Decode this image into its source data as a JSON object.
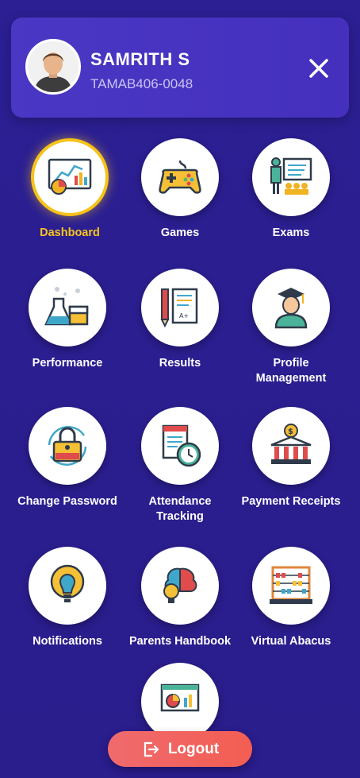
{
  "profile": {
    "name": "SAMRITH S",
    "id": "TAMAB406-0048",
    "avatar_icon": "user-avatar-icon"
  },
  "close_icon": "close-icon",
  "menu": [
    {
      "label": "Dashboard",
      "icon": "dashboard-chart-icon",
      "active": true
    },
    {
      "label": "Games",
      "icon": "gamepad-icon",
      "active": false
    },
    {
      "label": "Exams",
      "icon": "exam-classroom-icon",
      "active": false
    },
    {
      "label": "Performance",
      "icon": "lab-flask-icon",
      "active": false
    },
    {
      "label": "Results",
      "icon": "results-document-icon",
      "active": false
    },
    {
      "label": "Profile\nManagement",
      "icon": "graduate-icon",
      "active": false
    },
    {
      "label": "Change Password",
      "icon": "padlock-icon",
      "active": false
    },
    {
      "label": "Attendance\nTracking",
      "icon": "attendance-clock-icon",
      "active": false
    },
    {
      "label": "Payment Receipts",
      "icon": "bank-icon",
      "active": false
    },
    {
      "label": "Notifications",
      "icon": "lightbulb-icon",
      "active": false
    },
    {
      "label": "Parents Handbook",
      "icon": "brain-idea-icon",
      "active": false
    },
    {
      "label": "Virtual Abacus",
      "icon": "abacus-icon",
      "active": false
    },
    {
      "label": "",
      "icon": "analytics-board-icon",
      "active": false
    }
  ],
  "logout": {
    "label": "Logout",
    "icon": "logout-icon"
  },
  "colors": {
    "background": "#2a1e8f",
    "header": "#4632c0",
    "active": "#f8c51c",
    "logout": "#f0656a"
  }
}
